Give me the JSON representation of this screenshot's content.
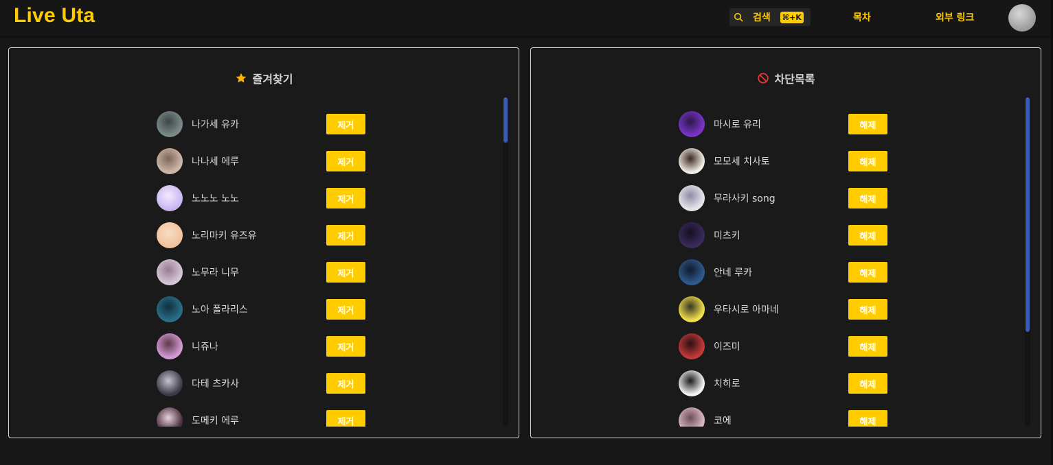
{
  "brand": "Live Uta",
  "header": {
    "search_label": "검색",
    "search_shortcut": "⌘+K",
    "nav": [
      {
        "label": "목차"
      },
      {
        "label": "외부 링크"
      }
    ]
  },
  "favorites": {
    "title": "즐겨찾기",
    "action_label": "제거",
    "items": [
      {
        "name": "나가세 유카",
        "colors": [
          "#7b8a88",
          "#3d4646"
        ]
      },
      {
        "name": "나나세 에루",
        "colors": [
          "#cdb7a8",
          "#7d6658"
        ]
      },
      {
        "name": "노노노 노노",
        "colors": [
          "#c9b7f0",
          "#f3e9ff"
        ]
      },
      {
        "name": "노리마키 유즈유",
        "colors": [
          "#f3c29d",
          "#f7ddc4"
        ]
      },
      {
        "name": "노무라 니무",
        "colors": [
          "#d5c6d8",
          "#9a7b91"
        ]
      },
      {
        "name": "노아 폴라리스",
        "colors": [
          "#2a6f87",
          "#0f2f3d"
        ]
      },
      {
        "name": "니쥬나",
        "colors": [
          "#d49ad6",
          "#5b3a47"
        ]
      },
      {
        "name": "다테 츠카사",
        "colors": [
          "#3c3a48",
          "#c6c2cf"
        ]
      },
      {
        "name": "도메키 에루",
        "colors": [
          "#4b2f3d",
          "#e6d3dc"
        ]
      }
    ]
  },
  "blocked": {
    "title": "차단목록",
    "action_label": "해제",
    "items": [
      {
        "name": "마시로 유리",
        "colors": [
          "#7a34c7",
          "#2a1847"
        ]
      },
      {
        "name": "모모세 치사토",
        "colors": [
          "#f2ede6",
          "#3a2a22"
        ]
      },
      {
        "name": "무라사키 song",
        "colors": [
          "#e6e6ee",
          "#8f8ca3"
        ]
      },
      {
        "name": "미츠키",
        "colors": [
          "#3a2a5c",
          "#14101f"
        ]
      },
      {
        "name": "안네 루카",
        "colors": [
          "#2f5a8c",
          "#101a2c"
        ]
      },
      {
        "name": "우타시로 아마네",
        "colors": [
          "#f1e04a",
          "#3a3524"
        ]
      },
      {
        "name": "이즈미",
        "colors": [
          "#c23a3a",
          "#2a1013"
        ]
      },
      {
        "name": "치히로",
        "colors": [
          "#f4f4f4",
          "#1a1a1a"
        ]
      },
      {
        "name": "코에",
        "colors": [
          "#d9b9c4",
          "#6d4b57"
        ]
      }
    ]
  },
  "colors": {
    "accent": "#ffcc00",
    "background": "#171717",
    "panel_border": "#d9d9d9",
    "scroll_thumb": "#3a5bb5"
  },
  "icons": {
    "favorites": "star-icon",
    "blocked": "block-icon",
    "search": "search-icon"
  }
}
